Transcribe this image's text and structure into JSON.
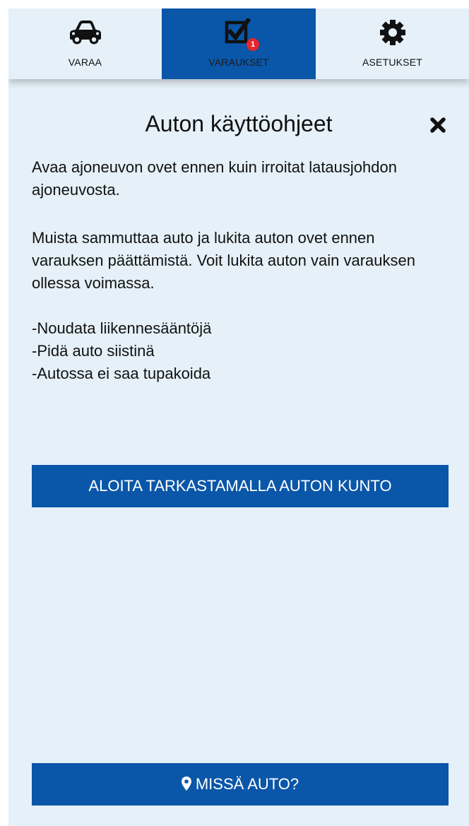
{
  "tabs": [
    {
      "label": "VARAA",
      "icon": "car-icon"
    },
    {
      "label": "VARAUKSET",
      "icon": "checkbox-icon",
      "badge": "1",
      "active": true
    },
    {
      "label": "ASETUKSET",
      "icon": "gear-icon"
    }
  ],
  "modal": {
    "title": "Auton käyttöohjeet",
    "paragraph_1": "Avaa ajoneuvon ovet ennen kuin irroitat latausjohdon ajoneuvosta.",
    "paragraph_2": "Muista sammuttaa auto ja lukita auton ovet ennen varauksen päättämistä. Voit lukita auton vain varauksen ollessa voimassa.",
    "rules": [
      "-Noudata liikennesääntöjä",
      "-Pidä auto siistinä",
      "-Autossa ei saa tupakoida"
    ],
    "start_button": "ALOITA TARKASTAMALLA AUTON KUNTO",
    "where_button": "MISSÄ AUTO?"
  },
  "colors": {
    "primary": "#0a56a8",
    "background": "#e5f0f8",
    "badge": "#e4262d"
  }
}
